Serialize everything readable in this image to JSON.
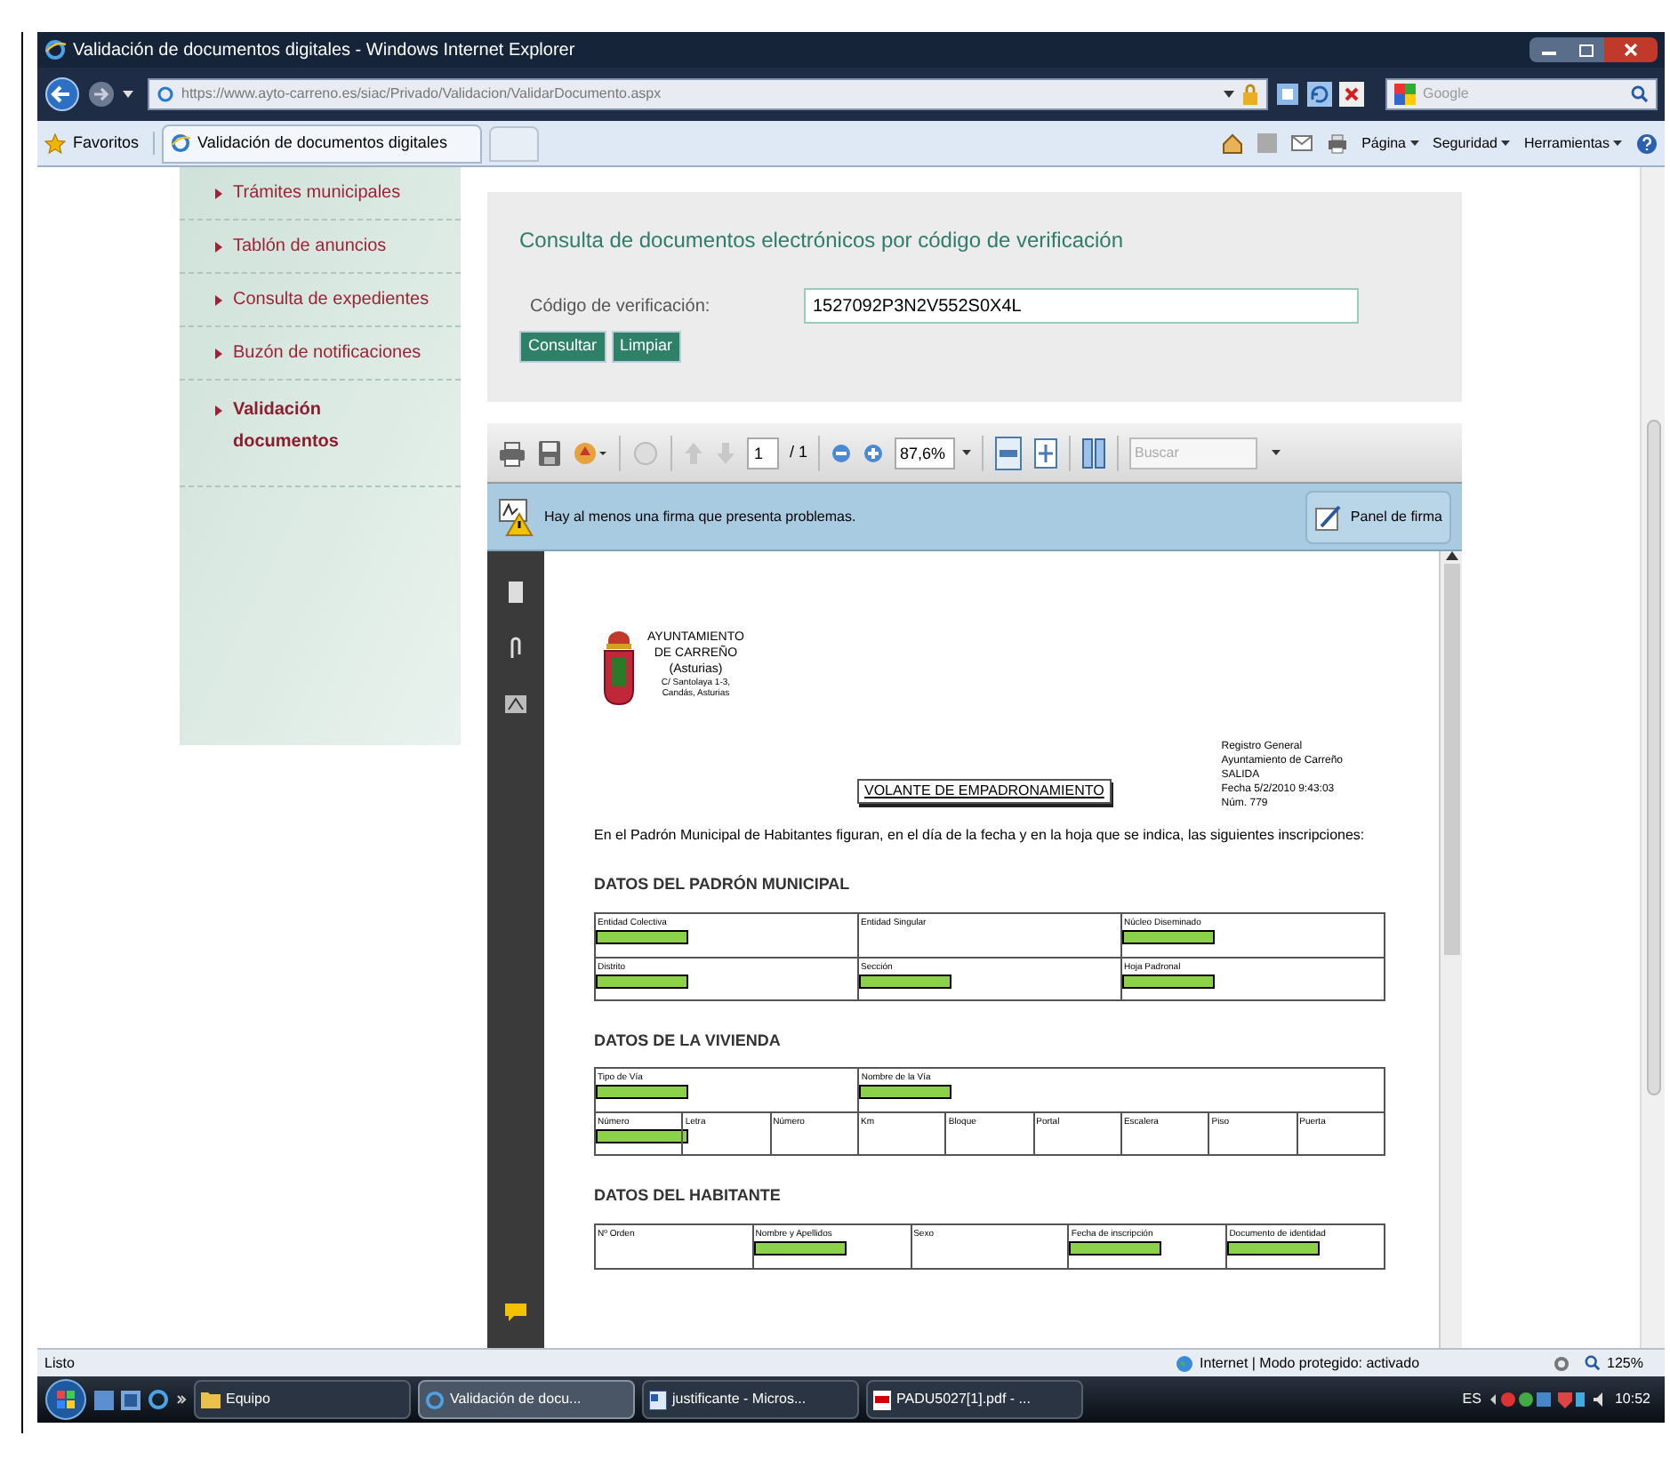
{
  "window": {
    "title": "Validación de documentos digitales - Windows Internet Explorer"
  },
  "address_bar": {
    "url": "https://www.ayto-carreno.es/siac/Privado/Validacion/ValidarDocumento.aspx",
    "search_placeholder": "Google"
  },
  "favorites_bar": {
    "favorites": "Favoritos",
    "tab": "Validación de documentos digitales",
    "commands": [
      "Página",
      "Seguridad",
      "Herramientas"
    ]
  },
  "sidebar": {
    "items": [
      {
        "label": "Trámites municipales",
        "selected": false
      },
      {
        "label": "Tablón de anuncios",
        "selected": false
      },
      {
        "label": "Consulta de expedientes",
        "selected": false
      },
      {
        "label": "Buzón de notificaciones",
        "selected": false
      },
      {
        "label": "Validación documentos",
        "selected": true
      }
    ]
  },
  "form": {
    "title": "Consulta de documentos electrónicos por código de verificación",
    "field_label": "Código de verificación:",
    "field_value": "1527092P3N2V552S0X4L",
    "buttons": [
      "Consultar",
      "Limpiar"
    ]
  },
  "pdf_viewer": {
    "page": "1",
    "page_count": "/ 1",
    "zoom": "87,6%",
    "search_placeholder": "Buscar",
    "notice": "Hay al menos una firma que presenta problemas.",
    "signature_panel": "Panel de firma"
  },
  "document": {
    "org_lines": [
      "AYUNTAMIENTO",
      "DE CARREÑO",
      "(Asturias)",
      "C/ Santolaya 1-3,",
      "Candás, Asturias"
    ],
    "title": "VOLANTE DE EMPADRONAMIENTO",
    "registry": [
      "Registro General",
      "Ayuntamiento de Carreño",
      "SALIDA",
      "Fecha 5/2/2010 9:43:03",
      "Núm. 779"
    ],
    "intro": "En el Padrón Municipal de Habitantes figuran, en el día de la fecha y en la hoja que se indica, las siguientes inscripciones:",
    "sections": [
      {
        "title": "DATOS DEL PADRÓN MUNICIPAL",
        "rows": [
          [
            {
              "label": "Entidad Colectiva",
              "redacted": true
            },
            {
              "label": "Entidad Singular",
              "redacted": false
            },
            {
              "label": "Núcleo Diseminado",
              "redacted": true
            }
          ],
          [
            {
              "label": "Distrito",
              "redacted": true
            },
            {
              "label": "Sección",
              "redacted": true
            },
            {
              "label": "Hoja Padronal",
              "redacted": true
            }
          ]
        ]
      },
      {
        "title": "DATOS DE LA VIVIENDA",
        "rows": [
          [
            {
              "label": "Tipo de Vía",
              "redacted": true
            },
            "",
            "",
            {
              "label": "Nombre de la Vía",
              "redacted": true
            },
            "",
            "",
            "",
            "",
            ""
          ],
          [
            {
              "label": "Número",
              "redacted": true
            },
            {
              "label": "Letra",
              "redacted": false
            },
            {
              "label": "Número",
              "redacted": false
            },
            {
              "label": "Km",
              "redacted": false
            },
            {
              "label": "Bloque",
              "redacted": false
            },
            {
              "label": "Portal",
              "redacted": false
            },
            {
              "label": "Escalera",
              "redacted": false
            },
            {
              "label": "Piso",
              "redacted": false
            },
            {
              "label": "Puerta",
              "redacted": false
            }
          ]
        ]
      },
      {
        "title": "DATOS DEL HABITANTE",
        "rows": [
          [
            {
              "label": "Nº Orden",
              "redacted": false
            },
            {
              "label": "Nombre y Apellidos",
              "redacted": true
            },
            {
              "label": "Sexo",
              "redacted": false
            },
            {
              "label": "Fecha de inscripción",
              "redacted": true
            },
            {
              "label": "Documento de identidad",
              "redacted": true
            }
          ]
        ]
      }
    ]
  },
  "status_bar": {
    "status": "Listo",
    "zone": "Internet | Modo protegido: activado",
    "zoom": "125%"
  },
  "taskbar": {
    "buttons": [
      {
        "label": "Equipo",
        "selected": false
      },
      {
        "label": "Validación de docu...",
        "selected": true
      },
      {
        "label": "justificante - Micros...",
        "selected": false
      },
      {
        "label": "PADU5027[1].pdf - ...",
        "selected": false
      }
    ],
    "language": "ES",
    "time": "10:52"
  }
}
